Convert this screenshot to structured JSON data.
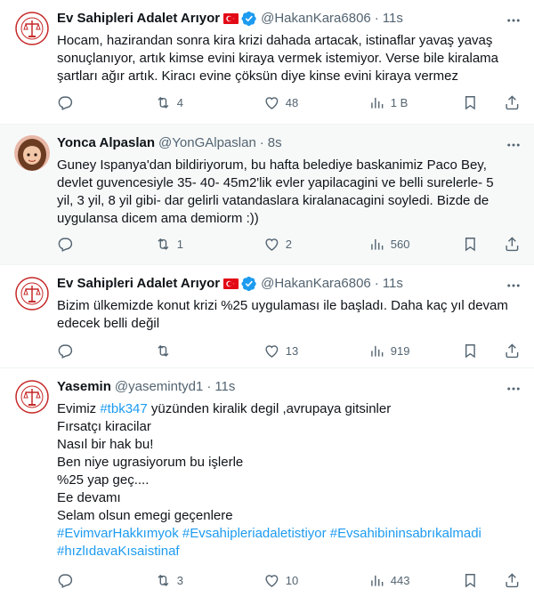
{
  "tweets": [
    {
      "name": "Ev Sahipleri Adalet Arıyor",
      "handle": "@HakanKara6806",
      "time": "11s",
      "text_lines": [
        "Hocam, hazirandan sonra kira krizi dahada artacak, istinaflar yavaş yavaş",
        "sonuçlanıyor, artık kimse evini kiraya vermek istemiyor. Verse bile kiralama",
        "şartları ağır artık. Kiracı evine çöksün diye kinse evini kiraya vermez"
      ],
      "replies": "",
      "retweets": "4",
      "likes": "48",
      "views": "1 B"
    },
    {
      "name": "Yonca Alpaslan",
      "handle": "@YonGAlpaslan",
      "time": "8s",
      "text_lines": [
        "Guney Ispanya'dan bildiriyorum, bu hafta belediye baskanimiz Paco Bey,",
        "devlet guvencesiyle 35- 40- 45m2'lik evler yapilacagini ve belli surelerle- 5",
        "yil, 3 yil, 8 yil gibi- dar gelirli vatandaslara kiralanacagini soyledi. Bizde de",
        "uygulansa dicem ama demiorm :))"
      ],
      "replies": "",
      "retweets": "1",
      "likes": "2",
      "views": "560"
    },
    {
      "name": "Ev Sahipleri Adalet Arıyor",
      "handle": "@HakanKara6806",
      "time": "11s",
      "text_lines": [
        "Bizim ülkemizde konut krizi %25 uygulaması ile başladı. Daha kaç yıl devam",
        "edecek belli değil"
      ],
      "replies": "",
      "retweets": "",
      "likes": "13",
      "views": "919"
    },
    {
      "name": "Yasemin",
      "handle": "@yasemintyd1",
      "time": "11s",
      "line1_before": "Evimiz ",
      "line1_tag": "#tbk347",
      "line1_after": " yüzünden kiralik degil ,avrupaya gitsinler",
      "text_lines": [
        "Fırsatçı kiracilar",
        "Nasıl bir hak bu!",
        "Ben niye ugrasiyorum bu işlerle",
        "%25 yap geç....",
        "Ee devamı",
        "Selam olsun emegi geçenlere"
      ],
      "hashtags_line1": "#EvimvarHakkımyok #Evsahipleriadaletistiyor #Evsahibininsabrıkalmadi",
      "hashtags_line2": "#hızlıdavaKısaistinaf",
      "replies": "",
      "retweets": "3",
      "likes": "10",
      "views": "443"
    }
  ],
  "colors": {
    "text": "#0f1419",
    "secondary": "#536471",
    "accent": "#1d9bf0",
    "divider": "#eff3f4",
    "highlight_bg": "#f7f9f9"
  }
}
